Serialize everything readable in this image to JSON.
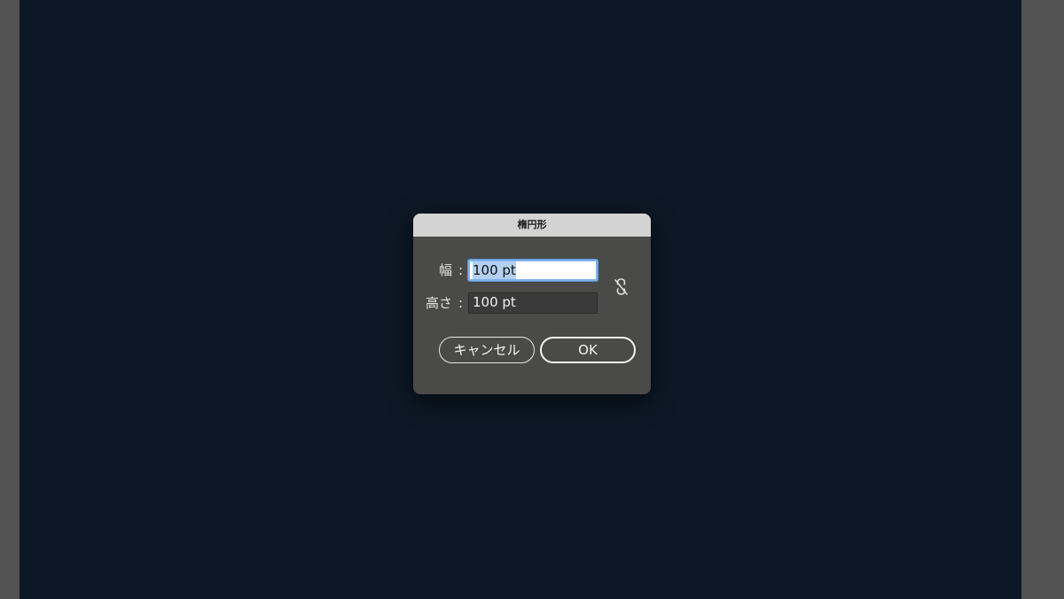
{
  "dialog": {
    "title": "楕円形",
    "width_label": "幅",
    "height_label": "高さ",
    "colon": ":",
    "width_value": "100 pt",
    "height_value": "100 pt",
    "constrain_icon": "link-broken-icon",
    "cancel_label": "キャンセル",
    "ok_label": "OK"
  },
  "colors": {
    "artboard": "#0c1825",
    "workspace": "#535353",
    "dialog_bg": "#4a4a49",
    "titlebar_bg": "#d3d3d3",
    "selection": "#b3d0f1",
    "focus_ring": "#7fb2ea"
  }
}
